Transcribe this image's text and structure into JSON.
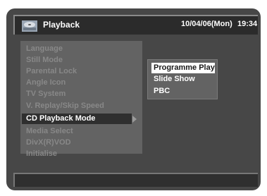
{
  "header": {
    "title": "Playback",
    "date": "10/04/06(Mon)",
    "time": "19:34",
    "icon": "playback-disc-icon"
  },
  "menu": {
    "items": [
      {
        "label": "Language",
        "state": "disabled"
      },
      {
        "label": "Still Mode",
        "state": "disabled"
      },
      {
        "label": "Parental Lock",
        "state": "disabled"
      },
      {
        "label": "Angle Icon",
        "state": "disabled"
      },
      {
        "label": "TV System",
        "state": "disabled"
      },
      {
        "label": "V. Replay/Skip Speed",
        "state": "disabled"
      },
      {
        "label": "CD Playback Mode",
        "state": "active"
      },
      {
        "label": "Media Select",
        "state": "disabled"
      },
      {
        "label": "DivX(R)VOD",
        "state": "disabled"
      },
      {
        "label": "Initialise",
        "state": "disabled"
      }
    ]
  },
  "submenu": {
    "items": [
      {
        "label": "Programme Play",
        "selected": true
      },
      {
        "label": "Slide Show",
        "selected": false
      },
      {
        "label": "PBC",
        "selected": false
      }
    ]
  },
  "colors": {
    "background": "#474747",
    "panel": "#636363",
    "highlight": "#2f2f2f",
    "disabled_text": "#888888",
    "selected_bg": "#ffffff"
  }
}
